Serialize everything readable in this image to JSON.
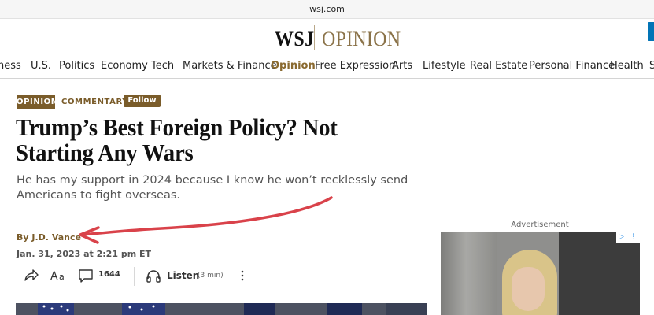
{
  "browser": {
    "url": "wsj.com"
  },
  "masthead": {
    "brand": "WSJ",
    "section": "OPINION"
  },
  "nav": {
    "items": [
      "ness",
      "U.S.",
      "Politics",
      "Economy",
      "Tech",
      "Markets & Finance",
      "Opinion",
      "Free Expression",
      "Arts",
      "Lifestyle",
      "Real Estate",
      "Personal Finance",
      "Health",
      "S"
    ],
    "active": "Opinion"
  },
  "article": {
    "tag": "OPINION",
    "category": "COMMENTARY",
    "follow_label": "Follow",
    "headline": "Trump’s Best Foreign Policy? Not Starting Any Wars",
    "dek": "He has my support in 2024 because I know he won’t recklessly send Americans to fight overseas.",
    "byline_prefix": "By",
    "author": "J.D. Vance",
    "timestamp": "Jan. 31, 2023 at 2:21 pm ET",
    "comment_count": "1644",
    "listen_label": "Listen",
    "listen_duration": "(3 min)"
  },
  "toolbar_icons": [
    "share-icon",
    "text-size-icon",
    "comment-icon",
    "headphones-icon",
    "more-icon"
  ],
  "ad": {
    "label": "Advertisement"
  },
  "colors": {
    "opinion_brown": "#7a5c2a",
    "annotation_red": "#d9424a",
    "brand_blue": "#0274b6"
  }
}
